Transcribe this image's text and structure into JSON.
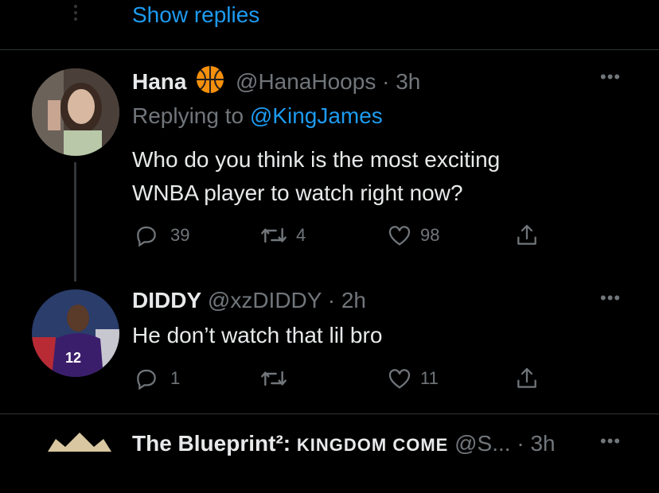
{
  "thread_top": {
    "show_replies": "Show replies"
  },
  "tweet1": {
    "name": "Hana",
    "badge": "basketball-emoji",
    "handle": "@HanaHoops",
    "dot": "·",
    "time": "3h",
    "replying_prefix": "Replying to",
    "replying_handle": "@KingJames",
    "text_line1": "Who do you think is the most exciting",
    "text_line2": "WNBA player to watch right now?",
    "replies": "39",
    "retweets": "4",
    "likes": "98"
  },
  "tweet2": {
    "name": "DIDDY",
    "handle": "@xzDIDDY",
    "dot": "·",
    "time": "2h",
    "text": "He don’t watch that lil bro",
    "replies": "1",
    "retweets": "",
    "likes": "11"
  },
  "tweet3": {
    "name": "The Blueprint²: ",
    "name_caps": "KINGDOM COME",
    "handle": "@S...",
    "dot": "·",
    "time": "3h"
  },
  "colors": {
    "background": "#000000",
    "text": "#e7e9ea",
    "muted": "#71767b",
    "accent": "#1d9bf0",
    "divider": "#2f3336"
  }
}
